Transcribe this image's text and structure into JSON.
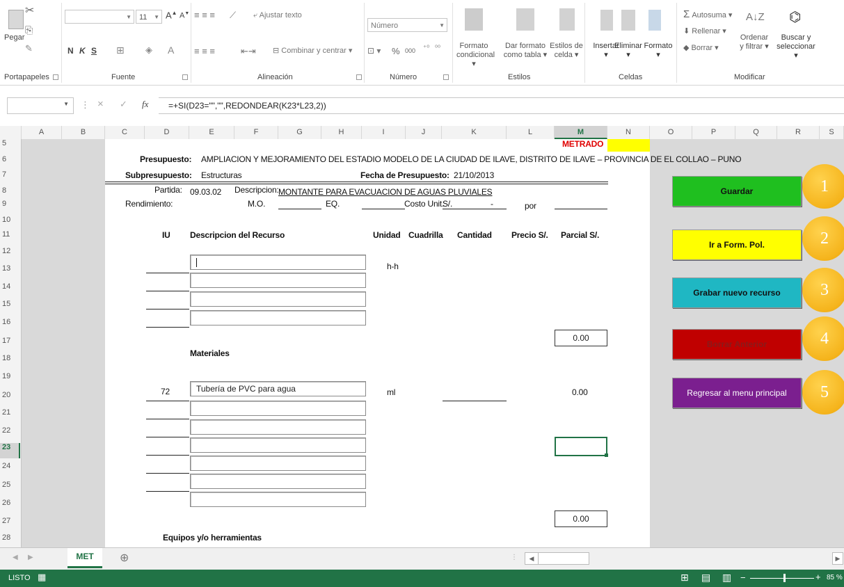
{
  "ribbon": {
    "clipboard": {
      "paste": "Pegar",
      "label": "Portapapeles"
    },
    "font": {
      "size": "11",
      "bold": "N",
      "italic": "K",
      "underline": "S",
      "label": "Fuente"
    },
    "alignment": {
      "wrap": "Ajustar texto",
      "merge": "Combinar y centrar",
      "label": "Alineación"
    },
    "number": {
      "format": "Número",
      "percent": "%",
      "thousands": "000",
      "label": "Número"
    },
    "styles": {
      "conditional": [
        "Formato",
        "condicional"
      ],
      "table": [
        "Dar formato",
        "como tabla"
      ],
      "cell": [
        "Estilos de",
        "celda"
      ],
      "label": "Estilos"
    },
    "cells": {
      "insert": "Insertar",
      "delete": "Eliminar",
      "format": "Formato",
      "label": "Celdas"
    },
    "editing": {
      "autosum": "Autosuma",
      "fill": "Rellenar",
      "clear": "Borrar",
      "sort": [
        "Ordenar",
        "y filtrar"
      ],
      "find": [
        "Buscar y",
        "seleccionar"
      ],
      "label": "Modificar"
    }
  },
  "formula_bar": {
    "fx": "fx",
    "cancel": "×",
    "enter": "✓",
    "formula": "=+SI(D23=\"\",\"\",REDONDEAR(K23*L23,2))"
  },
  "columns": [
    "A",
    "B",
    "C",
    "D",
    "E",
    "F",
    "G",
    "H",
    "I",
    "J",
    "K",
    "L",
    "M",
    "N",
    "O",
    "P",
    "Q",
    "R",
    "S"
  ],
  "rows": [
    "5",
    "6",
    "7",
    "8",
    "9",
    "10",
    "11",
    "12",
    "13",
    "14",
    "15",
    "16",
    "17",
    "18",
    "19",
    "20",
    "21",
    "22",
    "23",
    "24",
    "25",
    "26",
    "27",
    "28"
  ],
  "sheet": {
    "metrado": "METRADO",
    "presupuesto_label": "Presupuesto:",
    "presupuesto_value": "AMPLIACION Y MEJORAMIENTO DEL ESTADIO MODELO DE LA CIUDAD DE ILAVE, DISTRITO DE ILAVE – PROVINCIA DE EL COLLAO – PUNO",
    "subpresupuesto_label": "Subpresupuesto:",
    "subpresupuesto_value": "Estructuras",
    "fecha_label": "Fecha de Presupuesto:",
    "fecha_value": "21/10/2013",
    "partida_label": "Partida:",
    "partida_value": "09.03.02",
    "descripcion_label": "Descripcion:",
    "descripcion_value": "MONTANTE PARA EVACUACION DE AGUAS PLUVIALES",
    "rendimiento_label": "Rendimiento:",
    "mo_label": "M.O.",
    "eq_label": "EQ.",
    "costo_label": "Costo Unit.",
    "costo_currency": "S/.",
    "costo_value": "-",
    "por_label": "por",
    "hdr_iu": "IU",
    "hdr_desc": "Descripcion del Recurso",
    "hdr_unidad": "Unidad",
    "hdr_cuadrilla": "Cuadrilla",
    "hdr_cantidad": "Cantidad",
    "hdr_precio": "Precio S/.",
    "hdr_parcial": "Parcial S/.",
    "hh_unit": "h-h",
    "subtotal_labor": "0.00",
    "materiales": "Materiales",
    "mat_iu": "72",
    "mat_desc": "Tubería de PVC para agua",
    "mat_unit": "ml",
    "mat_parcial": "0.00",
    "subtotal_mat": "0.00",
    "equipos": "Equipos y/o herramientas"
  },
  "buttons": [
    {
      "label": "Guardar",
      "num": "1",
      "bg": "#1fbf1f",
      "fg": "#111"
    },
    {
      "label": "Ir a Form. Pol.",
      "num": "2",
      "bg": "#ffff00",
      "fg": "#111"
    },
    {
      "label": "Grabar nuevo recurso",
      "num": "3",
      "bg": "#1fb7c3",
      "fg": "#111"
    },
    {
      "label": "Borrar Anterior",
      "num": "4",
      "bg": "#c00000",
      "fg": "#8a1a1a"
    },
    {
      "label": "Regresar al menu principal",
      "num": "5",
      "bg": "#7b1f8f",
      "fg": "#ffffff"
    }
  ],
  "tabs": {
    "active": "MET",
    "add": "⊕"
  },
  "status": {
    "mode": "LISTO",
    "zoom": "85 %"
  }
}
